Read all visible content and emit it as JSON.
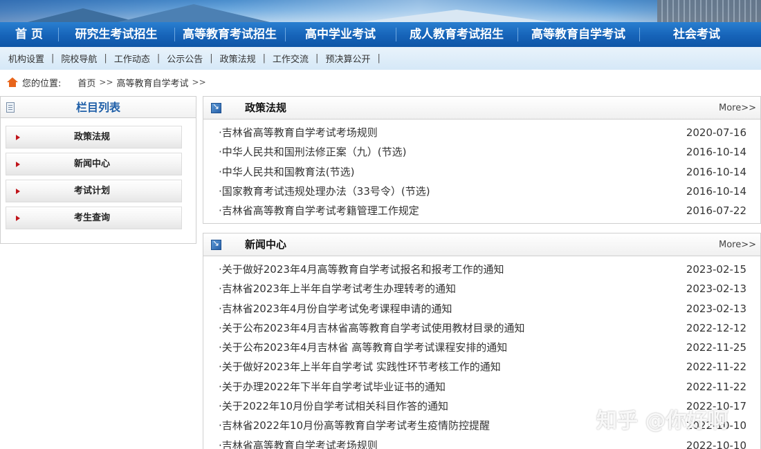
{
  "main_nav": [
    "首 页",
    "研究生考试招生",
    "高等教育考试招生",
    "高中学业考试",
    "成人教育考试招生",
    "高等教育自学考试",
    "社会考试"
  ],
  "sub_nav": [
    "机构设置",
    "院校导航",
    "工作动态",
    "公示公告",
    "政策法规",
    "工作交流",
    "预决算公开"
  ],
  "breadcrumb": {
    "label": "您的位置:",
    "home": "首页",
    "sep1": ">>",
    "current": "高等教育自学考试",
    "sep2": ">>"
  },
  "sidebar": {
    "title": "栏目列表",
    "items": [
      "政策法规",
      "新闻中心",
      "考试计划",
      "考生查询"
    ]
  },
  "policy_panel": {
    "title": "政策法规",
    "more": "More>>",
    "rows": [
      {
        "title": "·吉林省高等教育自学考试考场规则",
        "date": "2020-07-16"
      },
      {
        "title": "·中华人民共和国刑法修正案（九）(节选)",
        "date": "2016-10-14"
      },
      {
        "title": "·中华人民共和国教育法(节选)",
        "date": "2016-10-14"
      },
      {
        "title": "·国家教育考试违规处理办法（33号令）(节选)",
        "date": "2016-10-14"
      },
      {
        "title": "·吉林省高等教育自学考试考籍管理工作规定",
        "date": "2016-07-22"
      }
    ]
  },
  "news_panel": {
    "title": "新闻中心",
    "more": "More>>",
    "rows": [
      {
        "title": "·关于做好2023年4月高等教育自学考试报名和报考工作的通知",
        "date": "2023-02-15"
      },
      {
        "title": "·吉林省2023年上半年自学考试考生办理转考的通知",
        "date": "2023-02-13"
      },
      {
        "title": "·吉林省2023年4月份自学考试免考课程申请的通知",
        "date": "2023-02-13"
      },
      {
        "title": "·关于公布2023年4月吉林省高等教育自学考试使用教材目录的通知",
        "date": "2022-12-12"
      },
      {
        "title": "·关于公布2023年4月吉林省 高等教育自学考试课程安排的通知",
        "date": "2022-11-25"
      },
      {
        "title": "·关于做好2023年上半年自学考试 实践性环节考核工作的通知",
        "date": "2022-11-22"
      },
      {
        "title": "·关于办理2022年下半年自学考试毕业证书的通知",
        "date": "2022-11-22"
      },
      {
        "title": "·关于2022年10月份自学考试相关科目作答的通知",
        "date": "2022-10-17"
      },
      {
        "title": "·吉林省2022年10月份高等教育自学考试考生疫情防控提醒",
        "date": "2022-10-10"
      },
      {
        "title": "·吉林省高等教育自学考试考场规则",
        "date": "2022-10-10"
      }
    ]
  },
  "watermark": "知乎 @你好啊"
}
